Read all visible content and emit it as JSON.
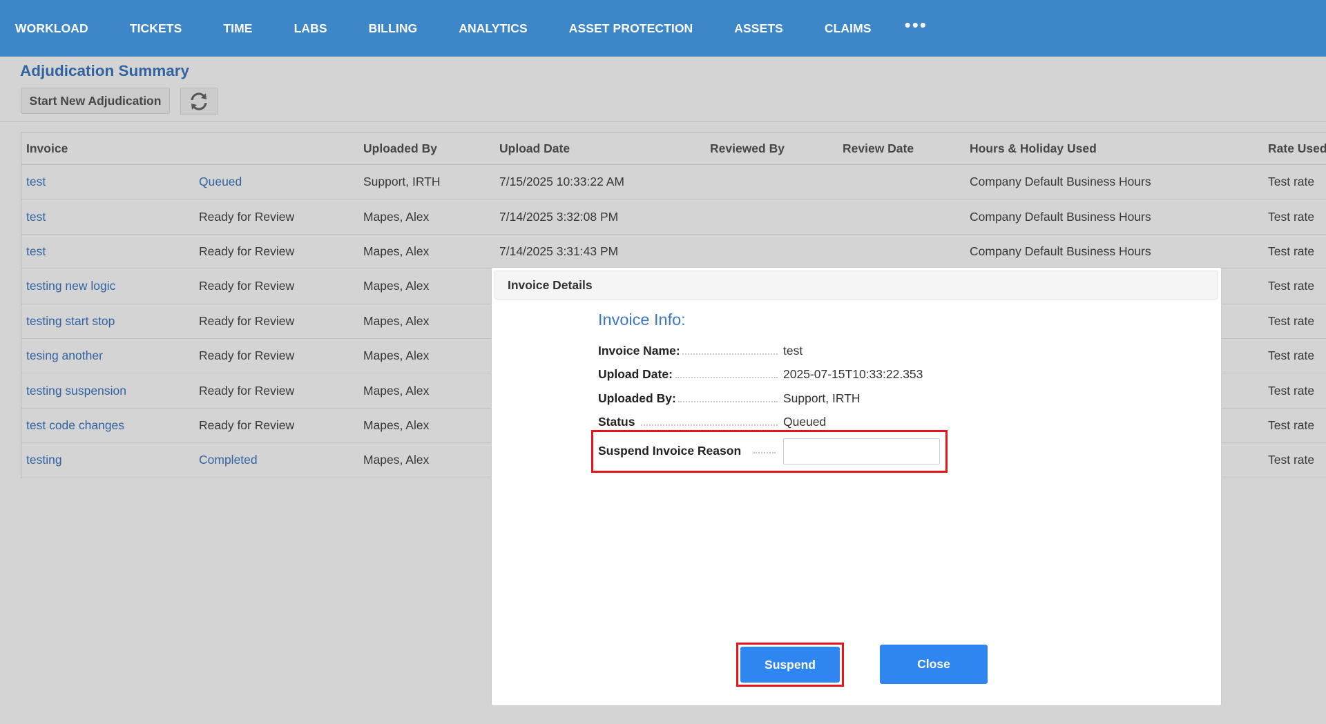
{
  "nav": {
    "items": [
      "WORKLOAD",
      "TICKETS",
      "TIME",
      "LABS",
      "BILLING",
      "ANALYTICS",
      "ASSET PROTECTION",
      "ASSETS",
      "CLAIMS"
    ],
    "more_icon": "more-dots-icon"
  },
  "page": {
    "title": "Adjudication Summary",
    "start_button": "Start New Adjudication",
    "refresh_icon": "refresh-icon"
  },
  "table": {
    "headers": [
      "Invoice",
      "",
      "Uploaded By",
      "Upload Date",
      "Reviewed By",
      "Review Date",
      "Hours & Holiday Used",
      "Rate Used"
    ],
    "rows": [
      {
        "invoice": "test",
        "status": "Queued",
        "uploaded_by": "Support, IRTH",
        "upload_date": "7/15/2025 10:33:22 AM",
        "reviewed_by": "",
        "review_date": "",
        "hours": "Company Default Business Hours",
        "rate": "Test rate"
      },
      {
        "invoice": "test",
        "status": "Ready for Review",
        "uploaded_by": "Mapes, Alex",
        "upload_date": "7/14/2025 3:32:08 PM",
        "reviewed_by": "",
        "review_date": "",
        "hours": "Company Default Business Hours",
        "rate": "Test rate"
      },
      {
        "invoice": "test",
        "status": "Ready for Review",
        "uploaded_by": "Mapes, Alex",
        "upload_date": "7/14/2025 3:31:43 PM",
        "reviewed_by": "",
        "review_date": "",
        "hours": "Company Default Business Hours",
        "rate": "Test rate"
      },
      {
        "invoice": "testing new logic",
        "status": "Ready for Review",
        "uploaded_by": "Mapes, Alex",
        "upload_date": "",
        "reviewed_by": "",
        "review_date": "",
        "hours": "",
        "rate": "Test rate"
      },
      {
        "invoice": "testing start stop",
        "status": "Ready for Review",
        "uploaded_by": "Mapes, Alex",
        "upload_date": "",
        "reviewed_by": "",
        "review_date": "",
        "hours": "",
        "rate": "Test rate"
      },
      {
        "invoice": "tesing another",
        "status": "Ready for Review",
        "uploaded_by": "Mapes, Alex",
        "upload_date": "",
        "reviewed_by": "",
        "review_date": "",
        "hours": "",
        "rate": "Test rate"
      },
      {
        "invoice": "testing suspension",
        "status": "Ready for Review",
        "uploaded_by": "Mapes, Alex",
        "upload_date": "",
        "reviewed_by": "",
        "review_date": "",
        "hours": "",
        "rate": "Test rate"
      },
      {
        "invoice": "test code changes",
        "status": "Ready for Review",
        "uploaded_by": "Mapes, Alex",
        "upload_date": "",
        "reviewed_by": "",
        "review_date": "",
        "hours": "",
        "rate": "Test rate"
      },
      {
        "invoice": "testing",
        "status": "Completed",
        "uploaded_by": "Mapes, Alex",
        "upload_date": "",
        "reviewed_by": "",
        "review_date": "",
        "hours": "",
        "rate": "Test rate"
      }
    ]
  },
  "modal": {
    "header": "Invoice Details",
    "info_title": "Invoice Info:",
    "fields": [
      {
        "label": "Invoice Name:",
        "value": "test"
      },
      {
        "label": "Upload Date:",
        "value": "2025-07-15T10:33:22.353"
      },
      {
        "label": "Uploaded By:",
        "value": "Support, IRTH"
      },
      {
        "label": "Status",
        "value": "Queued"
      }
    ],
    "reason_label": "Suspend Invoice Reason",
    "reason_value": "",
    "suspend_button": "Suspend",
    "close_button": "Close"
  },
  "colors": {
    "nav_bg": "#3d87c8",
    "link": "#3d78c2",
    "primary_button": "#2f86f0",
    "highlight": "#e8141b"
  }
}
